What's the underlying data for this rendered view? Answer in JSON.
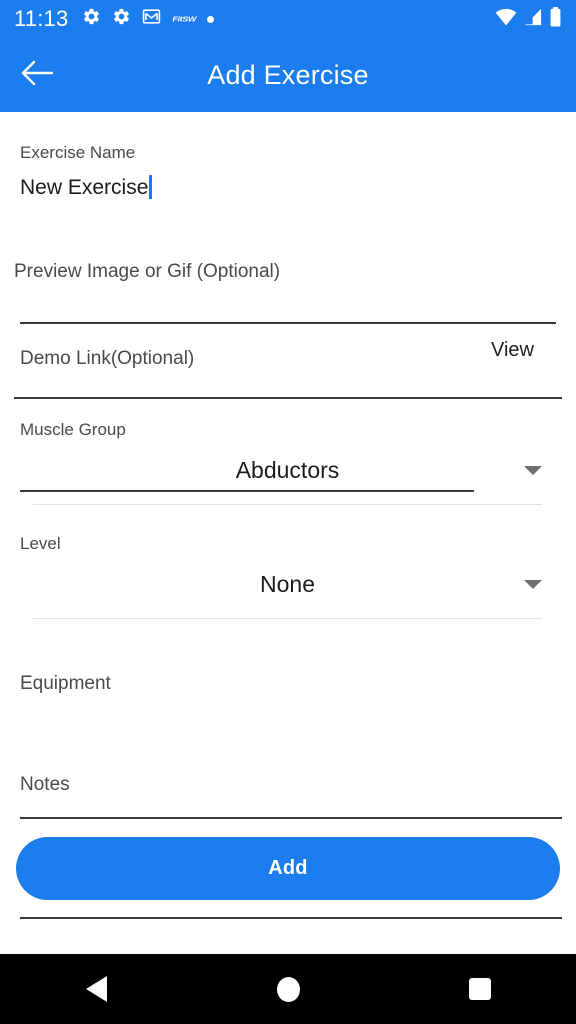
{
  "status_bar": {
    "time": "11:13",
    "left_icons": [
      "gear-icon",
      "gear-icon",
      "gmail-icon",
      "fitsw-logo",
      "dot-icon"
    ],
    "fitsw_label": "FitSW",
    "right_icons": [
      "wifi-icon",
      "cellular-signal-icon",
      "battery-icon"
    ],
    "background_color": "#1a7ced"
  },
  "app_bar": {
    "back_label": "Back",
    "title": "Add Exercise",
    "background_color": "#1a7ced",
    "text_color": "#ffffff"
  },
  "form": {
    "exercise_name": {
      "label": "Exercise Name",
      "value": "New Exercise",
      "placeholder": "Exercise Name",
      "focused": true
    },
    "preview_image": {
      "placeholder": "Preview Image or Gif (Optional)",
      "value": ""
    },
    "demo_link": {
      "placeholder": "Demo Link(Optional)",
      "value": "",
      "view_label": "View"
    },
    "muscle_group": {
      "label": "Muscle Group",
      "value": "Abductors"
    },
    "level": {
      "label": "Level",
      "value": "None"
    },
    "equipment": {
      "placeholder": "Equipment",
      "value": ""
    },
    "notes": {
      "placeholder": "Notes",
      "value": ""
    }
  },
  "primary_action": {
    "label": "Add",
    "color": "#1a7ced"
  },
  "nav_bar": {
    "back_label": "Back",
    "home_label": "Home",
    "recents_label": "Recent apps",
    "background_color": "#000000"
  }
}
